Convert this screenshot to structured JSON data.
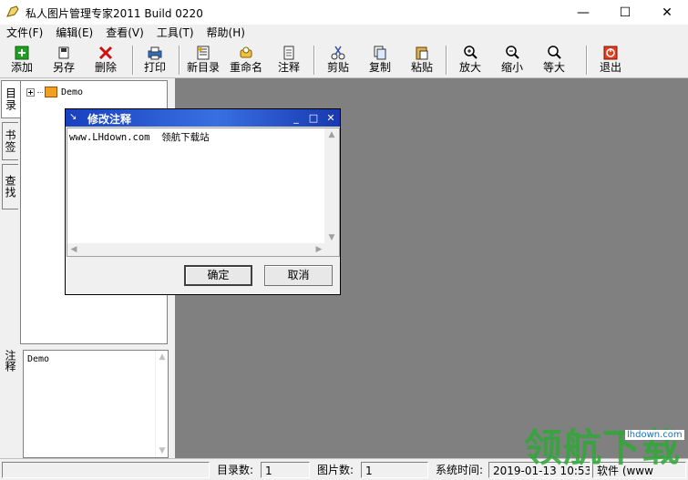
{
  "window": {
    "title": "私人图片管理专家2011 Build 0220",
    "controls": [
      "—",
      "☐",
      "✕"
    ]
  },
  "menu": [
    "文件(F)",
    "编辑(E)",
    "查看(V)",
    "工具(T)",
    "帮助(H)"
  ],
  "toolbar": [
    {
      "label": "添加",
      "icon": "add-icon"
    },
    {
      "label": "另存",
      "icon": "save-icon"
    },
    {
      "label": "删除",
      "icon": "delete-icon"
    },
    {
      "label": "打印",
      "icon": "print-icon"
    },
    {
      "label": "新目录",
      "icon": "new-folder-icon"
    },
    {
      "label": "重命名",
      "icon": "rename-icon"
    },
    {
      "label": "注释",
      "icon": "note-icon"
    },
    {
      "label": "剪贴",
      "icon": "cut-icon"
    },
    {
      "label": "复制",
      "icon": "copy-icon"
    },
    {
      "label": "粘贴",
      "icon": "paste-icon"
    },
    {
      "label": "放大",
      "icon": "zoom-in-icon"
    },
    {
      "label": "缩小",
      "icon": "zoom-out-icon"
    },
    {
      "label": "等大",
      "icon": "actual-size-icon"
    },
    {
      "label": "退出",
      "icon": "exit-icon"
    }
  ],
  "side_tabs": [
    "目录",
    "书签",
    "查找"
  ],
  "tree": {
    "root": "Demo"
  },
  "notes_panel": {
    "label": "注释",
    "text": "Demo"
  },
  "dialog": {
    "title": "修改注释",
    "content": "www.LHdown.com  领航下载站",
    "ok": "确定",
    "cancel": "取消"
  },
  "status": {
    "dir_count_label": "目录数:",
    "dir_count": "1",
    "pic_count_label": "图片数:",
    "pic_count": "1",
    "time_label": "系统时间:",
    "time": "2019-01-13 10:53",
    "extra": "软件 (www"
  },
  "watermark": {
    "text": "领航下载",
    "url": "lhdown.com"
  },
  "colors": {
    "canvas": "#808080",
    "dialog_title": "#1840c0",
    "watermark": "#30a838"
  }
}
